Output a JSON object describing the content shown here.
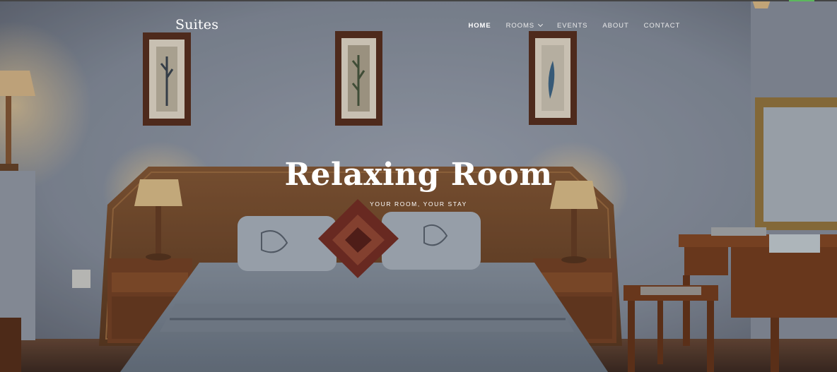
{
  "brand": {
    "logo": "Suites"
  },
  "nav": {
    "items": [
      {
        "label": "Home",
        "active": true,
        "has_dropdown": false
      },
      {
        "label": "Rooms",
        "active": false,
        "has_dropdown": true
      },
      {
        "label": "Events",
        "active": false,
        "has_dropdown": false
      },
      {
        "label": "About",
        "active": false,
        "has_dropdown": false
      },
      {
        "label": "Contact",
        "active": false,
        "has_dropdown": false
      }
    ]
  },
  "hero": {
    "title": "Relaxing Room",
    "subtitle": "Your Room, Your Stay"
  },
  "colors": {
    "accent": "#5cb85c",
    "wall": "#8e97a4",
    "wood": "#7a4a26",
    "text": "#ffffff"
  },
  "icons": {
    "rooms_dropdown": "chevron-down-icon"
  }
}
